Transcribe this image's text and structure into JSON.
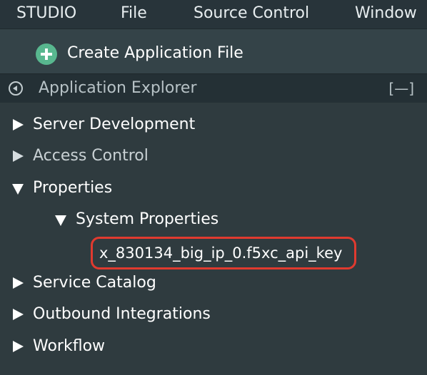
{
  "menubar": {
    "items": [
      {
        "label": "STUDIO"
      },
      {
        "label": "File"
      },
      {
        "label": "Source Control"
      },
      {
        "label": "Window"
      }
    ]
  },
  "create": {
    "label": "Create Application File",
    "icon": "plus-circle-icon",
    "icon_color": "#58b78f"
  },
  "explorer": {
    "title": "Application Explorer",
    "minimize_label": "[—]",
    "collapse_icon": "chevron-left-circle-icon"
  },
  "tree": {
    "items": [
      {
        "label": "Server Development",
        "state": "collapsed"
      },
      {
        "label": "Access Control",
        "state": "collapsed"
      },
      {
        "label": "Properties",
        "state": "expanded"
      },
      {
        "label": "System Properties",
        "state": "expanded"
      },
      {
        "label": "x_830134_big_ip_0.f5xc_api_key",
        "state": "leaf"
      },
      {
        "label": "Service Catalog",
        "state": "collapsed"
      },
      {
        "label": "Outbound Integrations",
        "state": "collapsed"
      },
      {
        "label": "Workflow",
        "state": "collapsed"
      }
    ]
  },
  "colors": {
    "background": "#2f3b3f",
    "menubar": "#28343a",
    "highlight_border": "#e03a2f",
    "accent_green": "#58b78f"
  }
}
